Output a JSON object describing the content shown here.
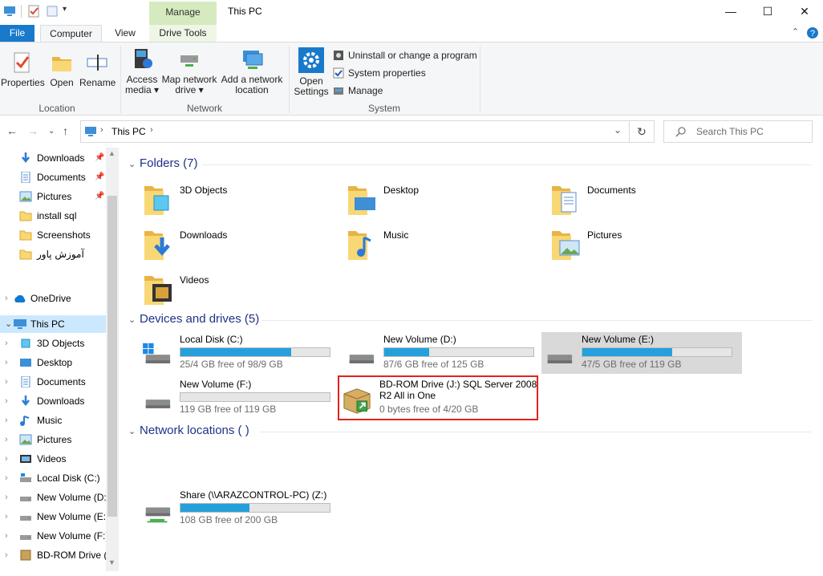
{
  "window": {
    "title": "This PC",
    "context_tab": "Manage",
    "minimize": "—",
    "maximize": "☐",
    "close": "✕"
  },
  "tabs": {
    "file": "File",
    "computer": "Computer",
    "view": "View",
    "drive_tools": "Drive Tools"
  },
  "ribbon": {
    "location": {
      "label": "Location",
      "properties": "Properties",
      "open": "Open",
      "rename": "Rename"
    },
    "network": {
      "label": "Network",
      "access_media_1": "Access",
      "access_media_2": "media ▾",
      "map_drive_1": "Map network",
      "map_drive_2": "drive ▾",
      "add_location_1": "Add a network",
      "add_location_2": "location"
    },
    "system": {
      "label": "System",
      "open_settings_1": "Open",
      "open_settings_2": "Settings",
      "uninstall": "Uninstall or change a program",
      "system_properties": "System properties",
      "manage": "Manage"
    }
  },
  "address": {
    "path": "This PC",
    "search_placeholder": "Search This PC"
  },
  "nav_pane": {
    "quick": [
      {
        "label": "Downloads",
        "pinned": true
      },
      {
        "label": "Documents",
        "pinned": true
      },
      {
        "label": "Pictures",
        "pinned": true
      },
      {
        "label": "install sql"
      },
      {
        "label": "Screenshots"
      },
      {
        "label": "آموزش پاور"
      }
    ],
    "onedrive": "OneDrive",
    "this_pc": "This PC",
    "pc_items": [
      "3D Objects",
      "Desktop",
      "Documents",
      "Downloads",
      "Music",
      "Pictures",
      "Videos",
      "Local Disk (C:)",
      "New Volume (D:",
      "New Volume (E:)",
      "New Volume (F:)",
      "BD-ROM Drive (."
    ]
  },
  "folders": {
    "heading": "Folders (7)",
    "items": [
      "3D Objects",
      "Desktop",
      "Documents",
      "Downloads",
      "Music",
      "Pictures",
      "Videos"
    ]
  },
  "drives": {
    "heading": "Devices and drives (5)",
    "items": [
      {
        "name": "Local Disk (C:)",
        "free": "25/4 GB free of 98/9 GB",
        "used_fraction": 0.74
      },
      {
        "name": "New Volume (D:)",
        "free": "87/6 GB free of 125 GB",
        "used_fraction": 0.3
      },
      {
        "name": "New Volume (E:)",
        "free": "47/5 GB free of 119 GB",
        "used_fraction": 0.6
      },
      {
        "name": "New Volume (F:)",
        "free": "119 GB free of 119 GB",
        "used_fraction": 0.0
      },
      {
        "name_1": "BD-ROM Drive (J:) SQL Server 2008",
        "name_2": "R2 All in One",
        "free": "0 bytes free of 4/20 GB"
      }
    ]
  },
  "network": {
    "heading": "Network locations (  )",
    "items": [
      {
        "name": "Share (\\\\ARAZCONTROL-PC) (Z:)",
        "free": "108 GB free of 200 GB",
        "used_fraction": 0.46
      }
    ]
  },
  "colors": {
    "accent": "#1979ca",
    "bar": "#26a0da",
    "heading": "#1e3287",
    "highlight": "#e2231a"
  }
}
